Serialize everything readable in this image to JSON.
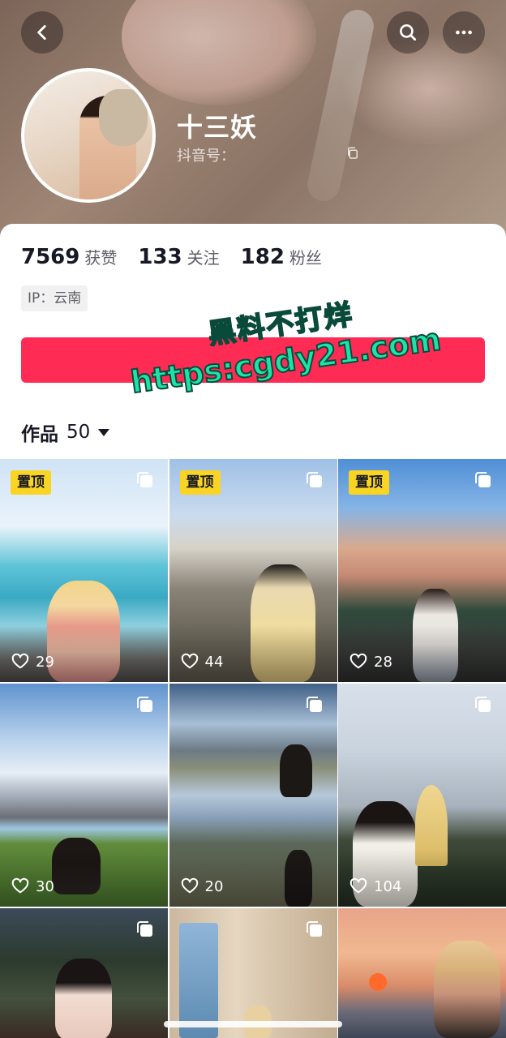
{
  "profile": {
    "name": "十三妖",
    "douyin_id_label": "抖音号："
  },
  "stats": [
    {
      "value": "7569",
      "label": "获赞"
    },
    {
      "value": "133",
      "label": "关注"
    },
    {
      "value": "182",
      "label": "粉丝"
    }
  ],
  "ip": "IP：云南",
  "follow_button_color": "#fe2c55",
  "watermark": {
    "line1": "黑料不打烊",
    "line2": "https:cgdy21.com"
  },
  "works": {
    "label": "作品",
    "count": "50"
  },
  "pinned_label": "置顶",
  "tiles": [
    {
      "likes": "29",
      "pinned": true
    },
    {
      "likes": "44",
      "pinned": true
    },
    {
      "likes": "28",
      "pinned": true
    },
    {
      "likes": "30",
      "pinned": false
    },
    {
      "likes": "20",
      "pinned": false
    },
    {
      "likes": "104",
      "pinned": false
    },
    {
      "likes": "",
      "pinned": false
    },
    {
      "likes": "",
      "pinned": false
    },
    {
      "likes": "",
      "pinned": false
    }
  ],
  "icons": {
    "back": "back-arrow-icon",
    "search": "search-icon",
    "more": "more-icon",
    "copy": "copy-icon",
    "heart": "heart-icon",
    "multi": "multi-image-icon"
  }
}
